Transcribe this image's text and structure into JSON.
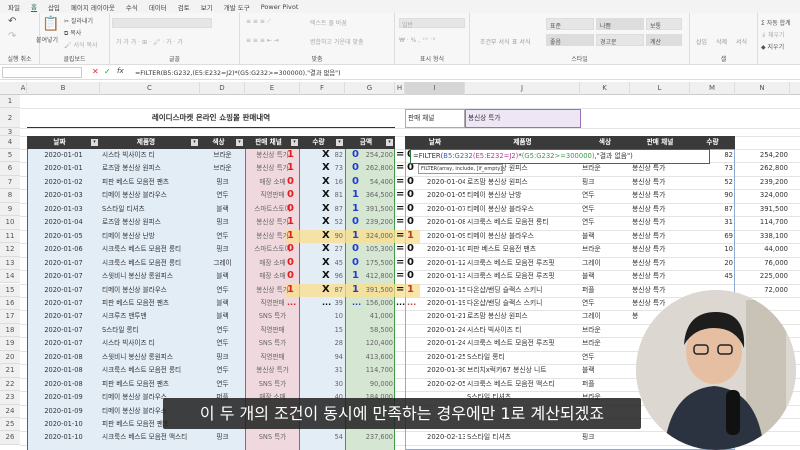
{
  "tabs": [
    "파일",
    "홈",
    "삽입",
    "페이지 레이아웃",
    "수식",
    "데이터",
    "검토",
    "보기",
    "개발 도구",
    "Power Pivot"
  ],
  "active_tab": 1,
  "ribbon": {
    "groups": [
      "실행 취소",
      "클립보드",
      "글꼴",
      "맞춤",
      "표시 형식",
      "스타일",
      "셀"
    ],
    "clipboard": {
      "paste": "붙여넣기",
      "cut": "잘라내기",
      "copy": "복사",
      "format_painter": "서식 복사"
    },
    "align": {
      "wrap": "텍스트 줄 바꿈",
      "merge": "병합하고 가운데 맞춤"
    },
    "number": {
      "format": "일반"
    },
    "styles": {
      "cond": "조건부 서식",
      "table": "표 서식",
      "cells": [
        "표준",
        "나쁨",
        "보통",
        "좋음",
        "경고문",
        "계산"
      ]
    },
    "cells": {
      "insert": "삽입",
      "delete": "삭제",
      "format": "서식"
    },
    "editing": {
      "autosum": "자동 합계",
      "fill": "채우기",
      "clear": "지우기"
    }
  },
  "formula_bar": {
    "name_box": "",
    "formula": "=FILTER(B5:G232,(E5:E232=J2)*(G5:G232>=300000),\"결과 없음\")"
  },
  "columns": [
    "A",
    "B",
    "C",
    "D",
    "E",
    "F",
    "G",
    "H",
    "I",
    "J",
    "K",
    "L",
    "M",
    "N"
  ],
  "title": "레이디스마켓 온라인 쇼핑몰 판매내역",
  "filter_label": "판매 채널",
  "filter_value": "봉신상 특가",
  "headers": [
    "날짜",
    "제품명",
    "색상",
    "판매 채널",
    "수량",
    "금액"
  ],
  "left_rows": [
    [
      "2020-01-01",
      "시스타 빅사이즈 티",
      "브라운",
      "봉신상 특가",
      "82",
      "254,200",
      "1",
      "X",
      "0",
      "=",
      "0"
    ],
    [
      "2020-01-01",
      "로즈맘 봉신상 원피스",
      "브라운",
      "봉신상 특가",
      "73",
      "262,800",
      "1",
      "X",
      "0",
      "=",
      "0"
    ],
    [
      "2020-01-02",
      "피판 베스트 모음전 팬츠",
      "핑크",
      "매장 소매",
      "16",
      "54,400",
      "0",
      "X",
      "0",
      "=",
      "0"
    ],
    [
      "2020-01-03",
      "티메이 봉신상 블라우스",
      "연두",
      "직영판매",
      "81",
      "364,500",
      "0",
      "X",
      "1",
      "=",
      "0"
    ],
    [
      "2020-01-03",
      "S스타일 티셔츠",
      "블랙",
      "스마트스토어",
      "87",
      "391,500",
      "0",
      "X",
      "1",
      "=",
      "0"
    ],
    [
      "2020-01-04",
      "로즈맘 봉신상 원피스",
      "핑크",
      "봉신상 특가",
      "52",
      "239,200",
      "1",
      "X",
      "0",
      "=",
      "0"
    ],
    [
      "2020-01-05",
      "티메이 봉신상 난방",
      "연두",
      "봉신상 특가",
      "90",
      "324,000",
      "1",
      "X",
      "1",
      "=",
      "1"
    ],
    [
      "2020-01-06",
      "시크룩스 베스트 모음전 롱티",
      "핑크",
      "스마트스토어",
      "27",
      "105,300",
      "0",
      "X",
      "0",
      "=",
      "0"
    ],
    [
      "2020-01-07",
      "시크룩스 베스트 모음전 롱티",
      "그레이",
      "매장 소매",
      "45",
      "175,500",
      "0",
      "X",
      "0",
      "=",
      "0"
    ],
    [
      "2020-01-07",
      "스윗비니 봉신상 롱원피스",
      "블랙",
      "매장 소매",
      "96",
      "412,800",
      "0",
      "X",
      "1",
      "=",
      "0"
    ],
    [
      "2020-01-07",
      "티메이 봉신상 블라우스",
      "연두",
      "봉신상 특가",
      "87",
      "391,500",
      "1",
      "X",
      "1",
      "=",
      "1"
    ],
    [
      "2020-01-07",
      "피판 베스트 모음전 팬츠",
      "블랙",
      "직영판매",
      "39",
      "156,000",
      "...",
      "...",
      "...",
      "...",
      "..."
    ],
    [
      "2020-01-07",
      "시크루즈 맨투맨",
      "블랙",
      "SNS 특가",
      "10",
      "41,000",
      "",
      "",
      "",
      "",
      ""
    ],
    [
      "2020-01-07",
      "S스타일 롱티",
      "연두",
      "직영판매",
      "15",
      "58,500",
      "",
      "",
      "",
      "",
      ""
    ],
    [
      "2020-01-07",
      "시스타 빅사이즈 티",
      "연두",
      "SNS 특가",
      "28",
      "120,400",
      "",
      "",
      "",
      "",
      ""
    ],
    [
      "2020-01-08",
      "스윗비니 봉신상 롱원피스",
      "핑크",
      "직영판매",
      "94",
      "413,600",
      "",
      "",
      "",
      "",
      ""
    ],
    [
      "2020-01-08",
      "시크룩스 베스트 모음전 롱티",
      "연두",
      "봉신상 특가",
      "31",
      "114,700",
      "",
      "",
      "",
      "",
      ""
    ],
    [
      "2020-01-08",
      "피판 베스트 모음전 팬츠",
      "연두",
      "SNS 특가",
      "30",
      "90,000",
      "",
      "",
      "",
      "",
      ""
    ],
    [
      "2020-01-09",
      "티메이 봉신상 블라우스",
      "퍼플",
      "매장 소매",
      "40",
      "184,000",
      "",
      "",
      "",
      "",
      ""
    ],
    [
      "2020-01-09",
      "티메이 봉신상 블라우스",
      "",
      "",
      "",
      "",
      "",
      "",
      "",
      "",
      ""
    ],
    [
      "2020-01-10",
      "피판 베스트 모음전 팬츠",
      "",
      "",
      "",
      "",
      "",
      "",
      "",
      "",
      ""
    ],
    [
      "2020-01-10",
      "시크룩스 베스트 모음전 맥스티",
      "핑크",
      "SNS 특가",
      "54",
      "237,600",
      "",
      "",
      "",
      "",
      ""
    ]
  ],
  "right_rows": [
    [
      "",
      "",
      "",
      "",
      "82",
      "254,200"
    ],
    [
      "2020-01-01",
      "로즈맘 봉신상 원피스",
      "브라운",
      "봉신상 특가",
      "73",
      "262,800"
    ],
    [
      "2020-01-04",
      "로즈맘 봉신상 원피스",
      "핑크",
      "봉신상 특가",
      "52",
      "239,200"
    ],
    [
      "2020-01-05",
      "티메이 봉신상 난방",
      "연두",
      "봉신상 특가",
      "90",
      "324,000"
    ],
    [
      "2020-01-07",
      "티메이 봉신상 블라우스",
      "연두",
      "봉신상 특가",
      "87",
      "391,500"
    ],
    [
      "2020-01-08",
      "시크룩스 베스트 모음전 롱티",
      "연두",
      "봉신상 특가",
      "31",
      "114,700"
    ],
    [
      "2020-01-09",
      "티메이 봉신상 블라우스",
      "블랙",
      "봉신상 특가",
      "69",
      "338,100"
    ],
    [
      "2020-01-10",
      "피판 베스트 모음전 팬츠",
      "브라운",
      "봉신상 특가",
      "10",
      "44,000"
    ],
    [
      "2020-01-12",
      "시크룩스 베스트 모음전 루즈핏",
      "그레이",
      "봉신상 특가",
      "20",
      "76,000"
    ],
    [
      "2020-01-13",
      "시크룩스 베스트 모음전 루즈핏",
      "블랙",
      "봉신상 특가",
      "45",
      "225,000"
    ],
    [
      "2020-01-15",
      "다온샵/밴딩 슬랙스 스키니",
      "퍼플",
      "봉신상 특가",
      "",
      "72,000"
    ],
    [
      "2020-01-19",
      "다온샵/밴딩 슬랙스 스키니",
      "연두",
      "봉신상 특가",
      "",
      ""
    ],
    [
      "2020-01-21",
      "로즈맘 봉신상 원피스",
      "그레이",
      "봉",
      "",
      ""
    ],
    [
      "2020-01-24",
      "시스타 빅사이즈 티",
      "브라운",
      "",
      "",
      ""
    ],
    [
      "2020-01-24",
      "시크룩스 베스트 모음전 루즈핏",
      "브라운",
      "",
      "",
      ""
    ],
    [
      "2020-01-25",
      "S스타일 롱티",
      "연두",
      "",
      "",
      ""
    ],
    [
      "2020-01-30",
      "브리치x럭키67 봉신상 니트",
      "블랙",
      "",
      "",
      ""
    ],
    [
      "2020-02-05",
      "시크룩스 베스트 모음전 맥스티",
      "퍼플",
      "",
      "",
      ""
    ],
    [
      "",
      "S스타일 티셔츠",
      "브라운",
      "",
      "",
      ""
    ],
    [
      "",
      "",
      "",
      "",
      "",
      ""
    ],
    [
      "",
      "",
      "",
      "",
      "",
      ""
    ],
    [
      "2020-02-13",
      "S스타일 티셔츠",
      "핑크",
      "",
      "",
      ""
    ]
  ],
  "formula_overlay": {
    "prefix": "=FILTER(",
    "arg1": "B5:G232",
    "arg2": "(E5:E232=J2)",
    "op": "*",
    "arg3": "(G5:G232>=300000)",
    "rest": ",\"결과 없음\")",
    "tooltip": "FILTER(array, include, [if_empty])"
  },
  "subtitle": "이 두 개의 조건이 동시에 만족하는 경우에만 1로 계산되겠죠",
  "colors": {
    "header_bg": "#3a3a3a",
    "red": "#e02020",
    "blue": "#1f3fd0",
    "green": "#2e8b3a",
    "highlight": "#fbe7a6",
    "accent": "#217346"
  }
}
